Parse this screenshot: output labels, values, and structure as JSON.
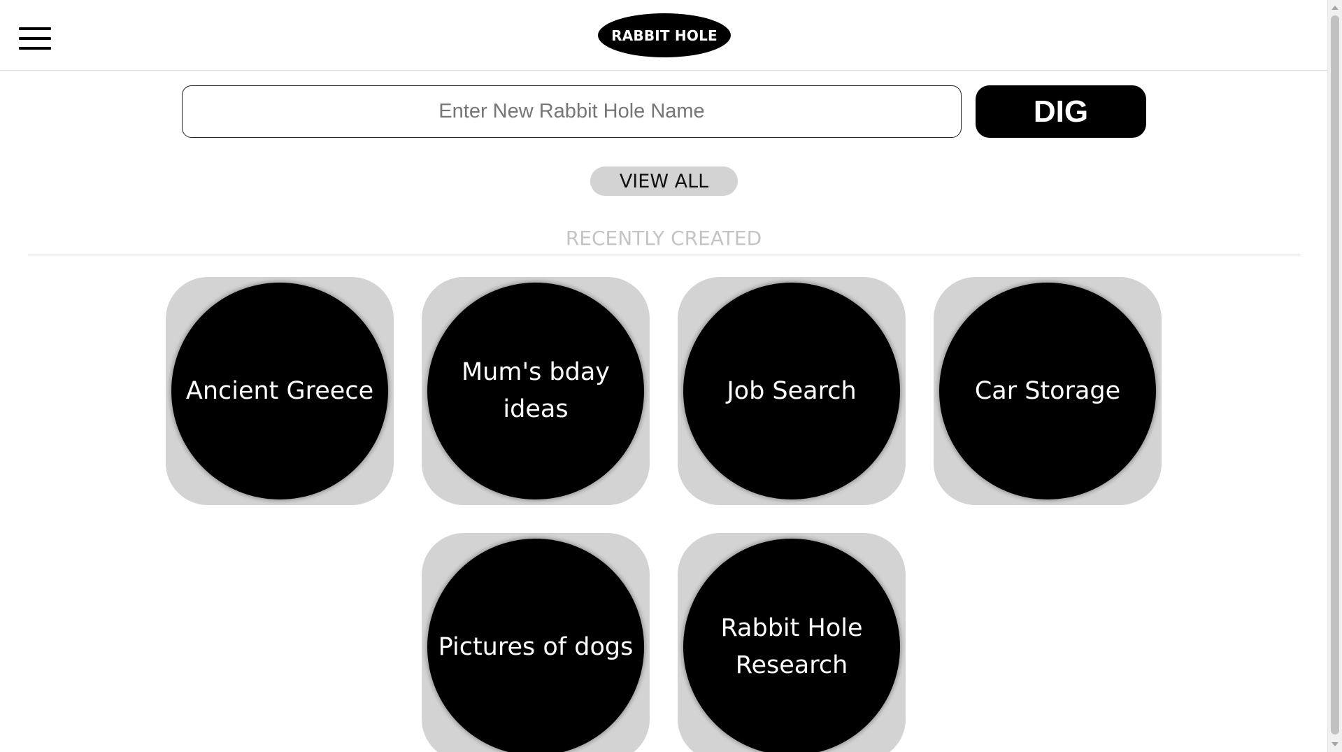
{
  "header": {
    "logo_text": "RABBIT HOLE",
    "menu_icon": "hamburger-menu-icon"
  },
  "create": {
    "input_placeholder": "Enter New Rabbit Hole Name",
    "input_value": "",
    "dig_label": "DIG"
  },
  "view_all_label": "VIEW ALL",
  "section": {
    "title": "RECENTLY CREATED"
  },
  "holes": [
    {
      "name": "Ancient Greece"
    },
    {
      "name": "Mum's bday ideas"
    },
    {
      "name": "Job Search"
    },
    {
      "name": "Car Storage"
    },
    {
      "name": "Pictures of dogs"
    },
    {
      "name": "Rabbit Hole Research"
    }
  ],
  "colors": {
    "primary": "#000000",
    "tile_background": "#d3d3d3",
    "section_title": "#c4c4c4",
    "text_on_dark": "#ffffff"
  }
}
